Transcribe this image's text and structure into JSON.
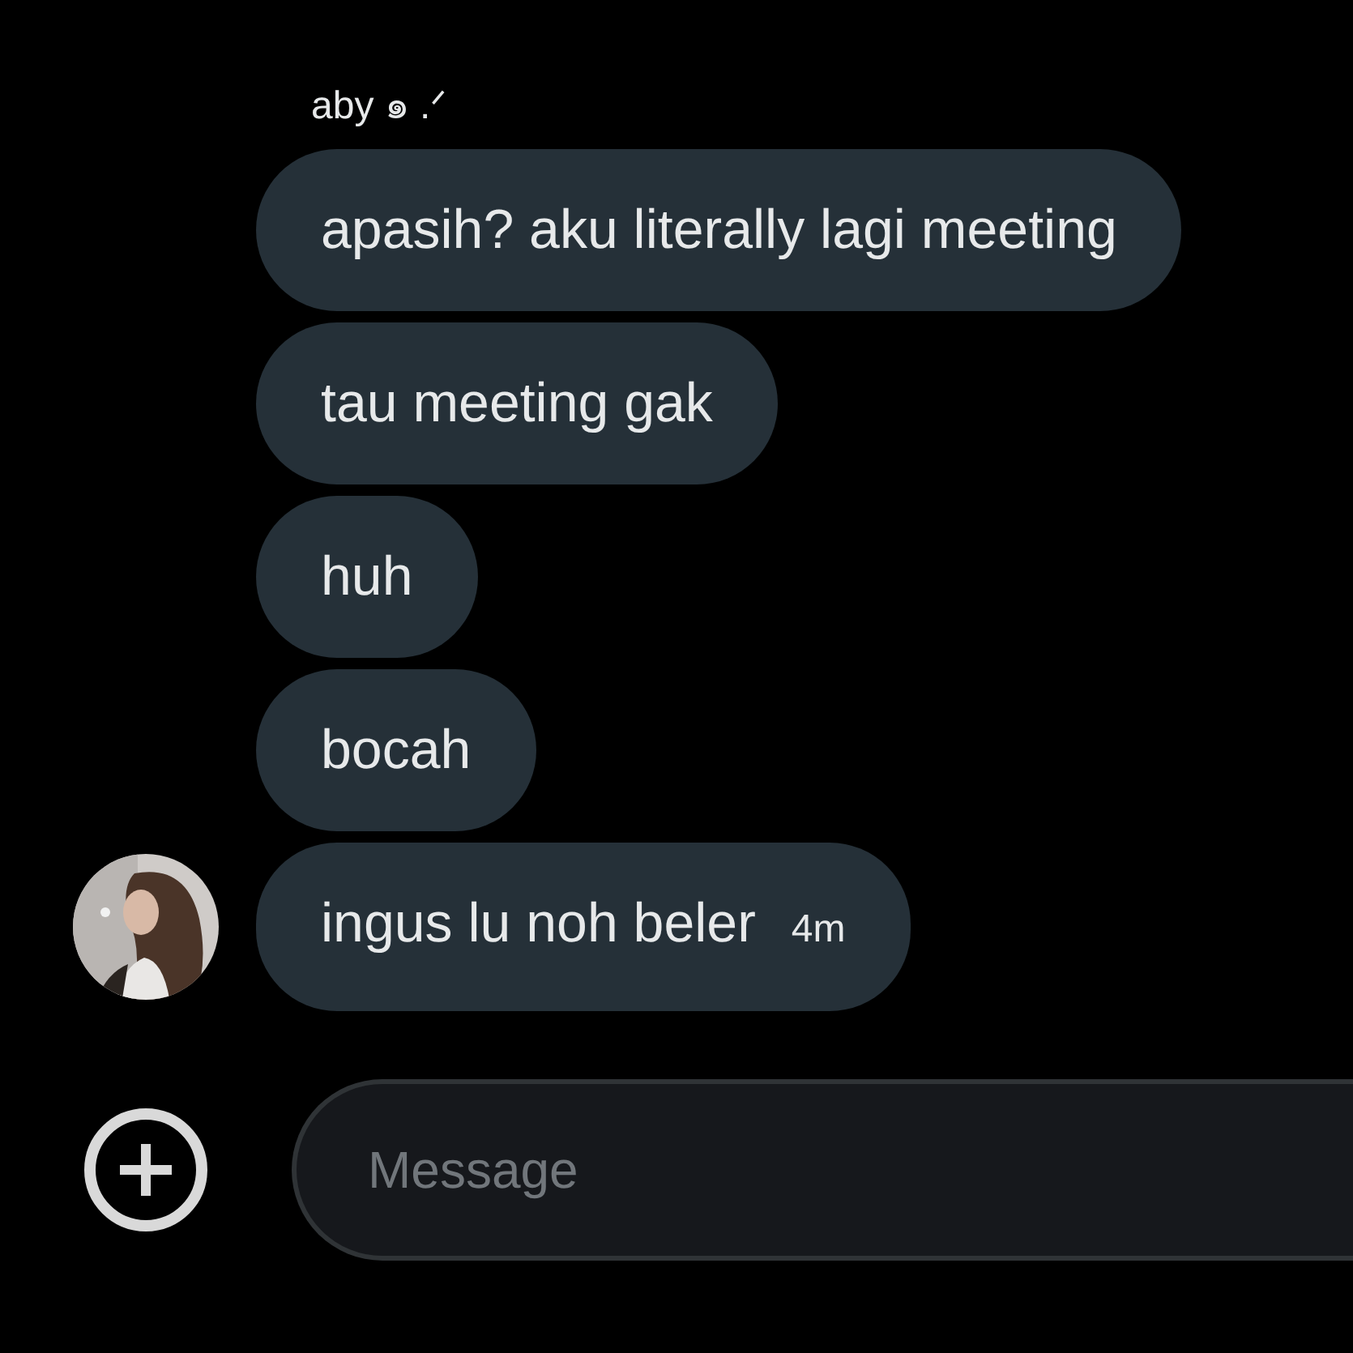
{
  "sender": {
    "name": "aby ๑ .ᐟ"
  },
  "messages": [
    {
      "text": "apasih? aku literally lagi meeting"
    },
    {
      "text": "tau meeting gak"
    },
    {
      "text": "huh"
    },
    {
      "text": "bocah"
    },
    {
      "text": "ingus lu noh beler",
      "time": "4m"
    }
  ],
  "composer": {
    "placeholder": "Message"
  }
}
